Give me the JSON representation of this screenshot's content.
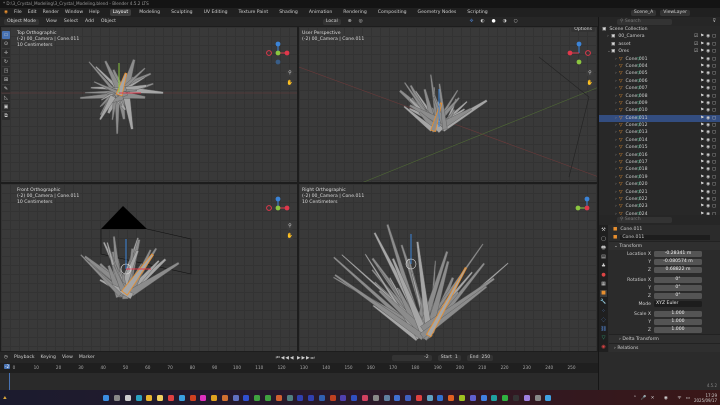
{
  "window": {
    "title": "* D:\\3_Crystal_Modeling\\3_Crystal_Modeling.blend - Blender 4.5.2 LTS"
  },
  "menu": [
    "File",
    "Edit",
    "Render",
    "Window",
    "Help"
  ],
  "workspaces": [
    {
      "label": "Layout",
      "active": true
    },
    {
      "label": "Modeling"
    },
    {
      "label": "Sculpting"
    },
    {
      "label": "UV Editing"
    },
    {
      "label": "Texture Paint"
    },
    {
      "label": "Shading"
    },
    {
      "label": "Animation"
    },
    {
      "label": "Rendering"
    },
    {
      "label": "Compositing"
    },
    {
      "label": "Geometry Nodes"
    },
    {
      "label": "Scripting"
    }
  ],
  "scene": {
    "name": "Scene_A",
    "view_layer": "ViewLayer"
  },
  "header": {
    "mode": "Object Mode",
    "items": [
      "View",
      "Select",
      "Add",
      "Object"
    ],
    "orientation": "Local",
    "options": "Options"
  },
  "viewports": [
    {
      "view": "Top Orthographic",
      "context": "(-2) 00_Camera | Cone.011",
      "scale": "10 Centimeters"
    },
    {
      "view": "User Perspective",
      "context": "(-2) 00_Camera | Cone.011",
      "scale": ""
    },
    {
      "view": "Front Orthographic",
      "context": "(-2) 00_Camera | Cone.011",
      "scale": "10 Centimeters"
    },
    {
      "view": "Right Orthographic",
      "context": "(-2) 00_Camera | Cone.011",
      "scale": "10 Centimeters"
    }
  ],
  "outliner": {
    "search_placeholder": "Search",
    "root": "Scene Collection",
    "collections": [
      "00_Camera",
      "asset",
      "Ores"
    ],
    "objects": [
      "Cone.001",
      "Cone.004",
      "Cone.005",
      "Cone.006",
      "Cone.007",
      "Cone.008",
      "Cone.009",
      "Cone.010",
      "Cone.011",
      "Cone.012",
      "Cone.013",
      "Cone.014",
      "Cone.015",
      "Cone.016",
      "Cone.017",
      "Cone.018",
      "Cone.019",
      "Cone.020",
      "Cone.021",
      "Cone.022",
      "Cone.023",
      "Cone.024"
    ],
    "selected": "Cone.011"
  },
  "properties": {
    "search_placeholder": "Search",
    "object": "Cone.011",
    "object_name": "Cone.011",
    "transform_label": "Transform",
    "location": {
      "label": "Location X",
      "x": "-0.28341 m",
      "y": "-0.080574 m",
      "z": "0.68822 m"
    },
    "rotation": {
      "label": "Rotation X",
      "x": "0°",
      "y": "0°",
      "z": "0°"
    },
    "mode": {
      "label": "Mode",
      "value": "XYZ Euler"
    },
    "scale": {
      "label": "Scale X",
      "x": "1.000",
      "y": "1.000",
      "z": "1.000"
    },
    "axis": {
      "y": "Y",
      "z": "Z"
    },
    "sections": [
      "Delta Transform",
      "Relations",
      "Collections",
      "Instancing",
      "Motion Paths"
    ],
    "version": "4.5.2"
  },
  "timeline": {
    "menus": [
      "Playback",
      "Keying",
      "View",
      "Marker"
    ],
    "current_frame": "-2",
    "start_label": "Start",
    "start": "1",
    "end_label": "End",
    "end": "250",
    "ticks": [
      "0",
      "10",
      "20",
      "30",
      "40",
      "50",
      "60",
      "70",
      "80",
      "90",
      "100",
      "110",
      "120",
      "130",
      "140",
      "150",
      "160",
      "170",
      "180",
      "190",
      "200",
      "210",
      "220",
      "230",
      "240",
      "250"
    ]
  },
  "taskbar": {
    "time": "17:29",
    "date": "2025/09/17"
  },
  "colors": {
    "accent": "#4772b3",
    "selection_orange": "#e88f2e",
    "x_axis": "#e0384b",
    "y_axis": "#8bc63f",
    "z_axis": "#3b84d8"
  }
}
